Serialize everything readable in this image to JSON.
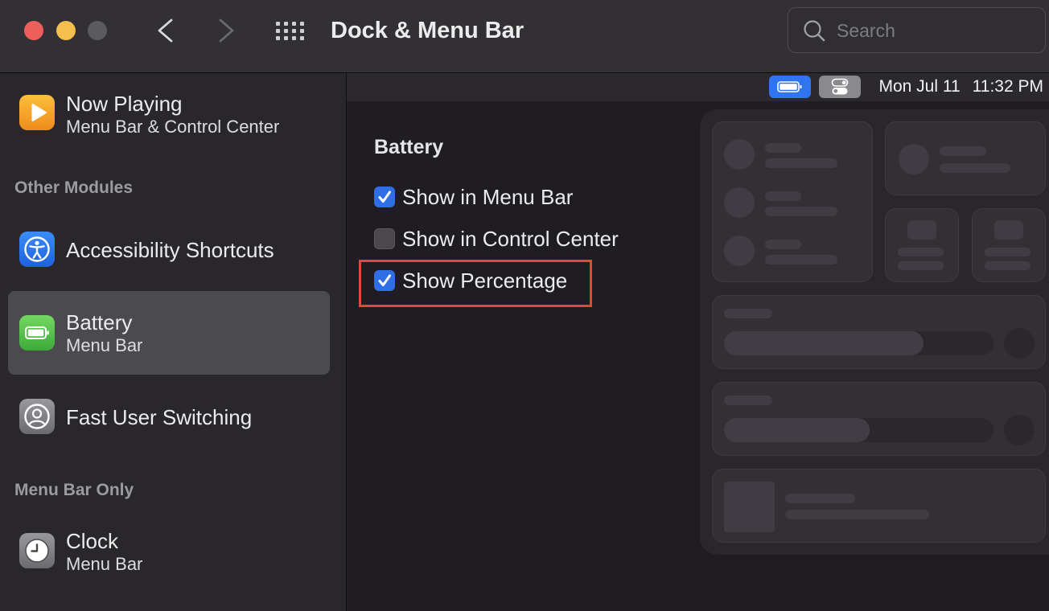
{
  "colors": {
    "close": "#ed5f5a",
    "minimize": "#f5bf4f",
    "zoom_inactive": "#5b5a5e",
    "accent": "#2f6ee4",
    "selection": "#4b4a4f",
    "annotation": "#e04a33"
  },
  "window": {
    "title": "Dock & Menu Bar",
    "toolbar": {
      "back_icon": "chevron-left-icon",
      "forward_icon": "chevron-right-icon",
      "forward_enabled": false,
      "show_all_icon": "grid-icon"
    },
    "search": {
      "placeholder": "Search",
      "value": "",
      "icon": "search-icon"
    }
  },
  "sidebar": {
    "top_items": [
      {
        "title": "Now Playing",
        "subtitle": "Menu Bar & Control Center",
        "icon": "play-icon",
        "selected": false
      }
    ],
    "sections": [
      {
        "header": "Other Modules",
        "items": [
          {
            "title": "Accessibility Shortcuts",
            "icon": "accessibility-icon",
            "selected": false
          },
          {
            "title": "Battery",
            "subtitle": "Menu Bar",
            "icon": "battery-icon",
            "selected": true
          },
          {
            "title": "Fast User Switching",
            "icon": "user-icon",
            "selected": false
          }
        ]
      },
      {
        "header": "Menu Bar Only",
        "items": [
          {
            "title": "Clock",
            "subtitle": "Menu Bar",
            "icon": "clock-icon",
            "selected": false
          }
        ]
      }
    ]
  },
  "content": {
    "menu_bar_preview": {
      "status_items": [
        {
          "icon": "battery-icon",
          "highlighted": true
        },
        {
          "icon": "control-center-icon",
          "highlighted": false
        }
      ],
      "date": "Mon Jul 11",
      "time": "11:32 PM"
    },
    "section_title": "Battery",
    "options": [
      {
        "label": "Show in Menu Bar",
        "checked": true,
        "annotated": false
      },
      {
        "label": "Show in Control Center",
        "checked": false,
        "annotated": false
      },
      {
        "label": "Show Percentage",
        "checked": true,
        "annotated": true
      }
    ],
    "control_center_preview": {
      "sliders": [
        {
          "level": 0.74
        },
        {
          "level": 0.54
        }
      ]
    }
  }
}
